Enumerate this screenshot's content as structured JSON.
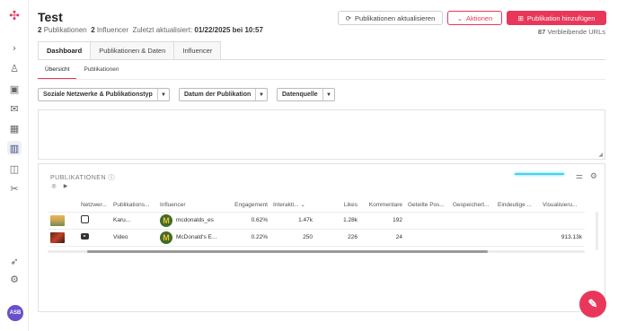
{
  "app": {
    "title": "Test",
    "meta": {
      "publications_count": "2",
      "publications_label": "Publikationen",
      "influencer_count": "2",
      "influencer_label": "Influencer",
      "updated_label": "Zuletzt aktualisiert:",
      "updated_value": "01/22/2025 bei 10:57"
    }
  },
  "sidebar": {
    "avatar_initials": "ASB",
    "icons": [
      "logo-icon",
      "chevron-right-icon",
      "users-icon",
      "report-icon",
      "mail-icon",
      "calendar-icon",
      "chart-icon",
      "wallet-icon",
      "scissors-icon",
      "rocket-icon",
      "gear-icon"
    ]
  },
  "toolbar": {
    "refresh_label": "Publikationen aktualisieren",
    "actions_label": "Aktionen",
    "add_label": "Publikation hinzufügen",
    "remaining_count": "87",
    "remaining_label": "Verbleibende URLs"
  },
  "tabs": [
    "Dashboard",
    "Publikationen & Daten",
    "Influencer"
  ],
  "subtabs": [
    "Übersicht",
    "Publikationen"
  ],
  "filters": {
    "network": "Soziale Netzwerke & Publikationstyp",
    "date": "Datum der Publikation",
    "source": "Datenquelle"
  },
  "publications": {
    "title": "PUBLIKATIONEN",
    "columns": [
      "Netzwer...",
      "Publikations...",
      "Influencer",
      "Engagement",
      "Interakti...",
      "Likes",
      "Kommentare",
      "Geteilte Pos...",
      "Gespeichert...",
      "Eindeutige ...",
      "Visualisieru..."
    ],
    "rows": [
      {
        "network_icon": "instagram-icon",
        "type": "Karu...",
        "influencer": "mcdonalds_es",
        "engagement": "0.62%",
        "interactions": "1.47k",
        "likes": "1.28k",
        "comments": "192",
        "shares": "",
        "saved": "",
        "unique": "",
        "views": ""
      },
      {
        "network_icon": "youtube-icon",
        "type": "Video",
        "influencer": "McDonald's E...",
        "engagement": "0.22%",
        "interactions": "250",
        "likes": "226",
        "comments": "24",
        "shares": "",
        "saved": "",
        "unique": "",
        "views": "913.13k"
      }
    ]
  },
  "colors": {
    "accent": "#e8375a",
    "annotation": "#48d3e8"
  }
}
